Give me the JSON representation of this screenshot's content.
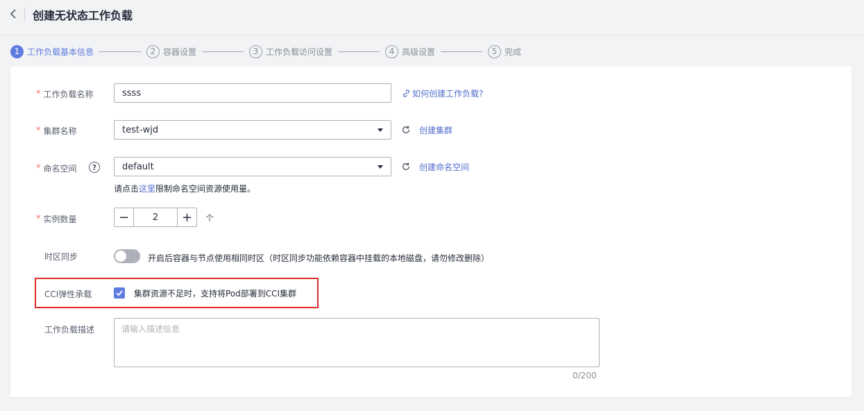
{
  "header": {
    "title": "创建无状态工作负载"
  },
  "steps": [
    {
      "num": "1",
      "label": "工作负载基本信息"
    },
    {
      "num": "2",
      "label": "容器设置"
    },
    {
      "num": "3",
      "label": "工作负载访问设置"
    },
    {
      "num": "4",
      "label": "高级设置"
    },
    {
      "num": "5",
      "label": "完成"
    }
  ],
  "colors": {
    "accent": "#5e7ce0",
    "link": "#526ecc",
    "required": "#f66f6a",
    "highlight_border": "#e02b2b"
  },
  "form": {
    "required_mark": "*",
    "workload_name": {
      "label": "工作负载名称",
      "value": "ssss",
      "help_link": "如何创建工作负载?"
    },
    "cluster": {
      "label": "集群名称",
      "value": "test-wjd",
      "create_link": "创建集群"
    },
    "namespace": {
      "label": "命名空间",
      "help_icon": "?",
      "value": "default",
      "create_link": "创建命名空间",
      "hint_prefix": "请点击",
      "hint_link": "这里",
      "hint_suffix": "限制命名空间资源使用量。"
    },
    "instances": {
      "label": "实例数量",
      "minus": "−",
      "value": "2",
      "plus": "+",
      "unit": "个"
    },
    "timezone": {
      "label": "时区同步",
      "enabled": false,
      "description": "开启后容器与节点使用相同时区（时区同步功能依赖容器中挂载的本地磁盘，请勿修改删除）"
    },
    "cci": {
      "label": "CCI弹性承载",
      "checked": true,
      "description": "集群资源不足时，支持将Pod部署到CCI集群"
    },
    "description": {
      "label": "工作负载描述",
      "placeholder": "请输入描述信息",
      "counter": "0/200"
    }
  }
}
